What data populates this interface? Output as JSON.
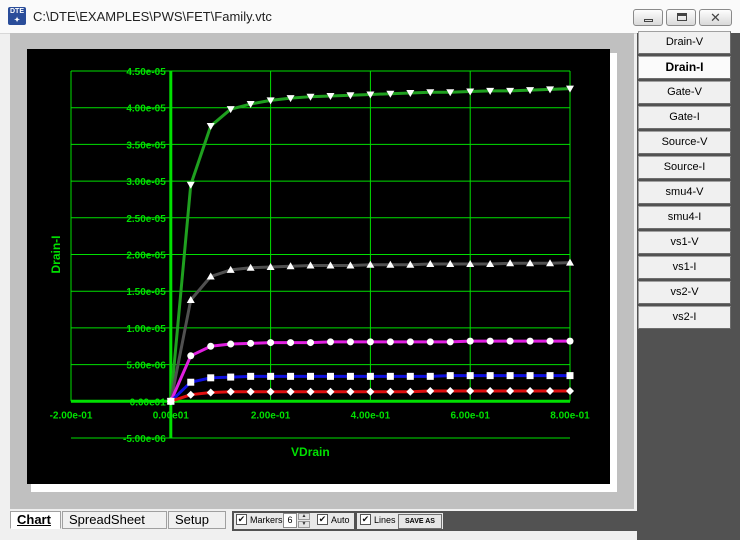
{
  "window": {
    "title": "C:\\DTE\\EXAMPLES\\PWS\\FET\\Family.vtc",
    "icon": "dte-app-icon",
    "controls": [
      "minimize",
      "maximize",
      "close"
    ]
  },
  "colors": {
    "plot_background": "#000000",
    "axis_and_grid": "#00e000",
    "series": [
      "#1fa01f",
      "#505050",
      "#e020e0",
      "#1010e0",
      "#e01010"
    ],
    "markers": "#ffffff"
  },
  "side_buttons": [
    {
      "label": "Drain-V",
      "active": false
    },
    {
      "label": "Drain-I",
      "active": true
    },
    {
      "label": "Gate-V",
      "active": false
    },
    {
      "label": "Gate-I",
      "active": false
    },
    {
      "label": "Source-V",
      "active": false
    },
    {
      "label": "Source-I",
      "active": false
    },
    {
      "label": "smu4-V",
      "active": false
    },
    {
      "label": "smu4-I",
      "active": false
    },
    {
      "label": "vs1-V",
      "active": false
    },
    {
      "label": "vs1-I",
      "active": false
    },
    {
      "label": "vs2-V",
      "active": false
    },
    {
      "label": "vs2-I",
      "active": false
    }
  ],
  "tabs": [
    {
      "label": "Chart",
      "active": true
    },
    {
      "label": "SpreadSheet",
      "active": false
    },
    {
      "label": "Setup",
      "active": false
    }
  ],
  "controls": {
    "markers": {
      "label": "Markers",
      "checked": true,
      "value": "6"
    },
    "auto": {
      "label": "Auto",
      "checked": true
    },
    "lines": {
      "label": "Lines",
      "checked": true
    },
    "save_label": "SAVE AS"
  },
  "chart_data": {
    "type": "line",
    "title": "",
    "xlabel": "VDrain",
    "ylabel": "Drain-I",
    "xlim": [
      -0.2,
      0.8
    ],
    "ylim": [
      -5e-06,
      4.5e-05
    ],
    "grid": true,
    "legend": "none",
    "x_ticks": [
      -0.2,
      0,
      0.2,
      0.4,
      0.6,
      0.8
    ],
    "x_tick_labels": [
      "-2.00e-01",
      "0.00e01",
      "2.00e-01",
      "4.00e-01",
      "6.00e-01",
      "8.00e-01"
    ],
    "y_ticks": [
      -5e-06,
      0,
      5e-06,
      1e-05,
      1.5e-05,
      2e-05,
      2.5e-05,
      3e-05,
      3.5e-05,
      4e-05,
      4.5e-05
    ],
    "y_tick_labels": [
      "-5.00e-06",
      "0.00e01",
      "5.00e-06",
      "1.00e-05",
      "1.50e-05",
      "2.00e-05",
      "2.50e-05",
      "3.00e-05",
      "3.50e-05",
      "4.00e-05",
      "4.50e-05"
    ],
    "x": [
      0,
      0.04,
      0.08,
      0.12,
      0.16,
      0.2,
      0.24,
      0.28,
      0.32,
      0.36,
      0.4,
      0.44,
      0.48,
      0.52,
      0.56,
      0.6,
      0.64,
      0.68,
      0.72,
      0.76,
      0.8
    ],
    "series": [
      {
        "color": "#1fa01f",
        "marker": "triangle-down",
        "values": [
          0,
          2.95e-05,
          3.75e-05,
          3.98e-05,
          4.05e-05,
          4.1e-05,
          4.13e-05,
          4.15e-05,
          4.16e-05,
          4.17e-05,
          4.18e-05,
          4.19e-05,
          4.2e-05,
          4.21e-05,
          4.21e-05,
          4.22e-05,
          4.23e-05,
          4.23e-05,
          4.24e-05,
          4.25e-05,
          4.26e-05
        ]
      },
      {
        "color": "#505050",
        "marker": "triangle-up",
        "values": [
          0,
          1.38e-05,
          1.7e-05,
          1.79e-05,
          1.82e-05,
          1.83e-05,
          1.84e-05,
          1.85e-05,
          1.85e-05,
          1.85e-05,
          1.86e-05,
          1.86e-05,
          1.86e-05,
          1.87e-05,
          1.87e-05,
          1.87e-05,
          1.87e-05,
          1.88e-05,
          1.88e-05,
          1.88e-05,
          1.89e-05
        ]
      },
      {
        "color": "#e020e0",
        "marker": "circle",
        "values": [
          0,
          6.2e-06,
          7.5e-06,
          7.8e-06,
          7.9e-06,
          8e-06,
          8e-06,
          8e-06,
          8.1e-06,
          8.1e-06,
          8.1e-06,
          8.1e-06,
          8.1e-06,
          8.1e-06,
          8.1e-06,
          8.2e-06,
          8.2e-06,
          8.2e-06,
          8.2e-06,
          8.2e-06,
          8.2e-06
        ]
      },
      {
        "color": "#1010e0",
        "marker": "square",
        "values": [
          0,
          2.6e-06,
          3.2e-06,
          3.3e-06,
          3.4e-06,
          3.4e-06,
          3.4e-06,
          3.4e-06,
          3.4e-06,
          3.4e-06,
          3.4e-06,
          3.4e-06,
          3.4e-06,
          3.4e-06,
          3.5e-06,
          3.5e-06,
          3.5e-06,
          3.5e-06,
          3.5e-06,
          3.5e-06,
          3.5e-06
        ]
      },
      {
        "color": "#e01010",
        "marker": "diamond",
        "values": [
          0,
          9e-07,
          1.2e-06,
          1.3e-06,
          1.3e-06,
          1.3e-06,
          1.3e-06,
          1.3e-06,
          1.3e-06,
          1.3e-06,
          1.3e-06,
          1.3e-06,
          1.3e-06,
          1.4e-06,
          1.4e-06,
          1.4e-06,
          1.4e-06,
          1.4e-06,
          1.4e-06,
          1.4e-06,
          1.4e-06
        ]
      }
    ]
  }
}
